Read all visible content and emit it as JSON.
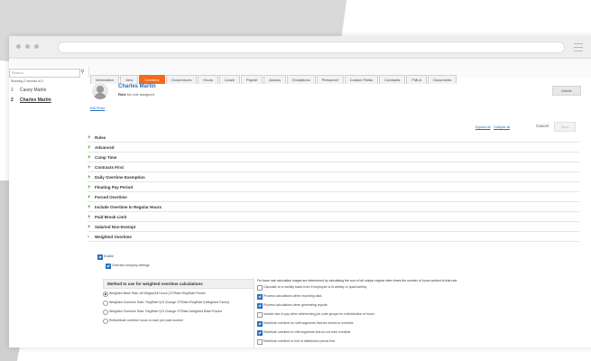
{
  "employee_list": {
    "search_placeholder": "Search",
    "showing": "Showing 2 records of 2",
    "records": [
      {
        "num": "1",
        "name": "Casey Martin"
      },
      {
        "num": "2",
        "name": "Charles Martin"
      }
    ]
  },
  "tabs": [
    "Information",
    "Jobs",
    "Overtime",
    "Occurrences",
    "Hours",
    "Leave",
    "Payroll",
    "Access",
    "Exceptions",
    "Personnel",
    "Custom Fields",
    "Contracts",
    "FMLA",
    "Documents"
  ],
  "active_tab": "Overtime",
  "profile": {
    "name": "Charles Martin",
    "role_label": "Role",
    "role_value": "No role assigned",
    "edit_photo": "Edit Photo",
    "delete_label": "Delete"
  },
  "actions": {
    "expand_all": "Expand all",
    "collapse_all": "Collapse all",
    "cancel": "Cancel",
    "save": "Save"
  },
  "sections": [
    {
      "label": "Rules",
      "state": "collapsed"
    },
    {
      "label": "Advanced",
      "state": "collapsed"
    },
    {
      "label": "Comp Time",
      "state": "collapsed"
    },
    {
      "label": "Contracts First",
      "state": "collapsed"
    },
    {
      "label": "Daily Overtime Exemption",
      "state": "collapsed"
    },
    {
      "label": "Floating Pay Period",
      "state": "collapsed"
    },
    {
      "label": "Forced Overtime",
      "state": "collapsed"
    },
    {
      "label": "Include Overtime In Regular Hours",
      "state": "collapsed"
    },
    {
      "label": "Paid Break Limit",
      "state": "collapsed"
    },
    {
      "label": "Salaried Non-Exempt",
      "state": "collapsed"
    },
    {
      "label": "Weighted Overtime",
      "state": "expanded"
    }
  ],
  "weighted": {
    "enable_label": "Enable",
    "override_label": "Override company settings",
    "method_title": "Method to use for weighted overtime calculations",
    "methods": [
      "Weighted Base Rate: All Wages/All Hours (OTRate=RegRate+Factor",
      "Weighted Overtime Rate: RegRate+(Ot Change OTRate=RegRate+(Weighted Factor)",
      "Weighted Overtime Rate: RegRate+(Ot Change OTRate=Weighted Base+Factor",
      "Redistribute overtime hours to each job code worked"
    ],
    "base_text": "For base rate calculation wages are determined by calculating the sum of all unique regular rates times the number of hours worked in that rate",
    "options": [
      {
        "label": "Calculate on a weekly basis even if employee is bi-weekly or quad-weekly",
        "checked": false
      },
      {
        "label": "Process calculations when exporting data",
        "checked": true
      },
      {
        "label": "Process calculations when generating reports",
        "checked": true
      },
      {
        "label": "Include rate of pay when determining job code groups for redistribution of hours",
        "checked": false
      },
      {
        "label": "Distribute overtime for shift segments that are forced to overtime",
        "checked": true
      },
      {
        "label": "Distribute overtime to shift segments that do not earn overtime",
        "checked": true
      },
      {
        "label": "Distribute overtime to end of distribution period first",
        "checked": false
      }
    ]
  }
}
